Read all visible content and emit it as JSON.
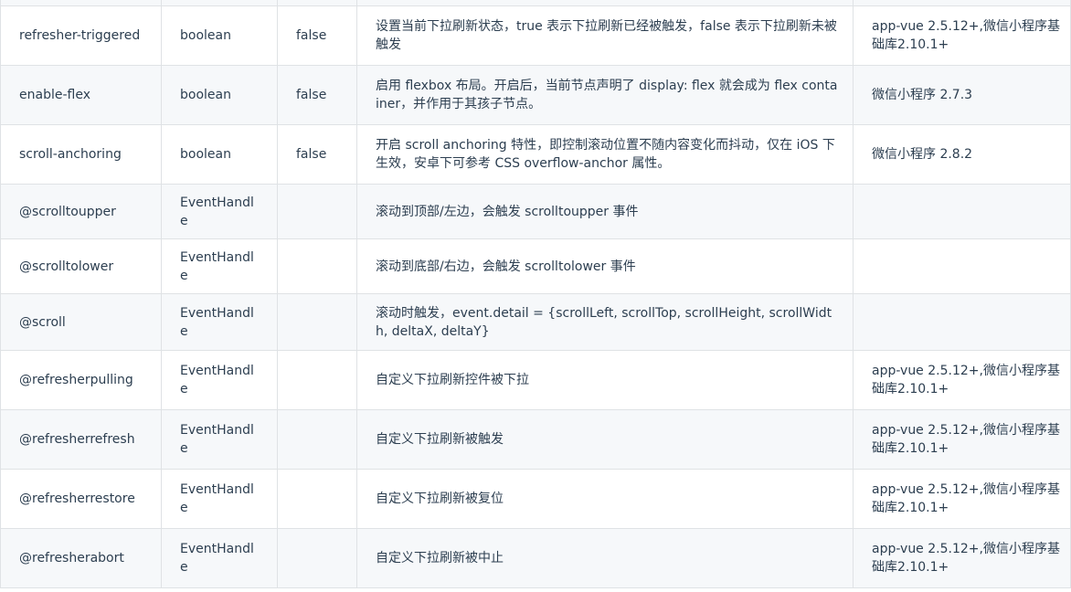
{
  "table": {
    "rows": [
      {
        "name": "refresher-triggered",
        "type": "boolean",
        "default": "false",
        "description": "设置当前下拉刷新状态，true 表示下拉刷新已经被触发，false 表示下拉刷新未被触发",
        "platform": "app-vue 2.5.12+,微信小程序基础库2.10.1+"
      },
      {
        "name": "enable-flex",
        "type": "boolean",
        "default": "false",
        "description": "启用 flexbox 布局。开启后，当前节点声明了 display: flex 就会成为 flex container，并作用于其孩子节点。",
        "platform": "微信小程序 2.7.3"
      },
      {
        "name": "scroll-anchoring",
        "type": "boolean",
        "default": "false",
        "description": "开启 scroll anchoring 特性，即控制滚动位置不随内容变化而抖动，仅在 iOS 下生效，安卓下可参考 CSS overflow-anchor 属性。",
        "platform": "微信小程序 2.8.2"
      },
      {
        "name": "@scrolltoupper",
        "type": "EventHandle",
        "default": "",
        "description": "滚动到顶部/左边，会触发 scrolltoupper 事件",
        "platform": ""
      },
      {
        "name": "@scrolltolower",
        "type": "EventHandle",
        "default": "",
        "description": "滚动到底部/右边，会触发 scrolltolower 事件",
        "platform": ""
      },
      {
        "name": "@scroll",
        "type": "EventHandle",
        "default": "",
        "description": "滚动时触发，event.detail = {scrollLeft, scrollTop, scrollHeight, scrollWidth, deltaX, deltaY}",
        "platform": ""
      },
      {
        "name": "@refresherpulling",
        "type": "EventHandle",
        "default": "",
        "description": "自定义下拉刷新控件被下拉",
        "platform": "app-vue 2.5.12+,微信小程序基础库2.10.1+"
      },
      {
        "name": "@refresherrefresh",
        "type": "EventHandle",
        "default": "",
        "description": "自定义下拉刷新被触发",
        "platform": "app-vue 2.5.12+,微信小程序基础库2.10.1+"
      },
      {
        "name": "@refresherrestore",
        "type": "EventHandle",
        "default": "",
        "description": "自定义下拉刷新被复位",
        "platform": "app-vue 2.5.12+,微信小程序基础库2.10.1+"
      },
      {
        "name": "@refresherabort",
        "type": "EventHandle",
        "default": "",
        "description": "自定义下拉刷新被中止",
        "platform": "app-vue 2.5.12+,微信小程序基础库2.10.1+"
      }
    ]
  }
}
